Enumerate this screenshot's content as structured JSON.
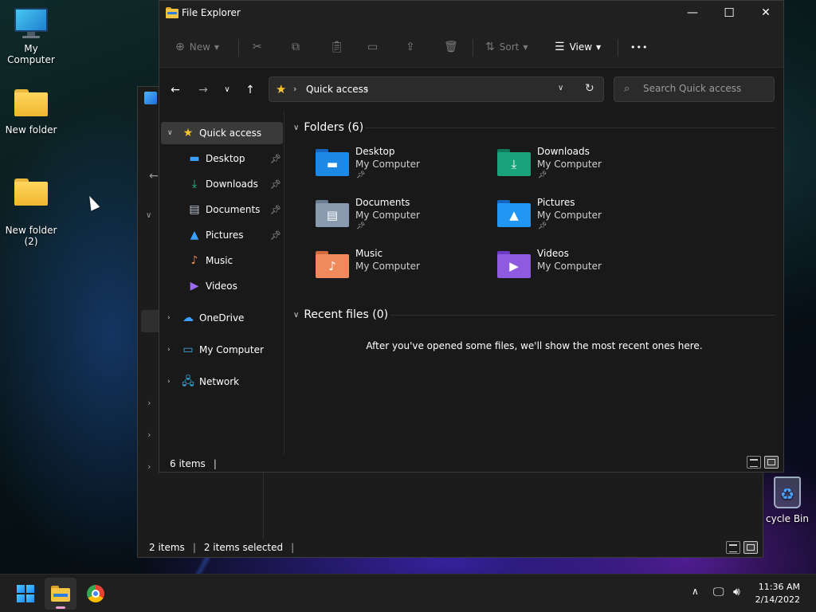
{
  "desktop": {
    "icons": [
      {
        "label": "My Computer",
        "icon": "monitor-icon"
      },
      {
        "label": "New folder",
        "icon": "folder-icon"
      },
      {
        "label": "New folder\n(2)",
        "icon": "folder-icon"
      }
    ],
    "recycle_bin_label": "cycle Bin"
  },
  "background_window": {
    "status_items_count": "2 items",
    "status_selected": "2 items selected"
  },
  "window": {
    "title": "File Explorer",
    "controls": {
      "minimize": "—",
      "maximize": "☐",
      "close": "✕"
    }
  },
  "command_bar": {
    "new_label": "New",
    "sort_label": "Sort",
    "view_label": "View",
    "more_label": "•••",
    "icons": [
      "new-icon",
      "cut-icon",
      "copy-icon",
      "paste-icon",
      "rename-icon",
      "share-icon",
      "delete-icon",
      "sort-icon",
      "view-icon",
      "more-icon"
    ]
  },
  "address_bar": {
    "path": "Quick access",
    "search_placeholder": "Search Quick access"
  },
  "nav_pane": {
    "quick_access": "Quick access",
    "pinned": [
      {
        "label": "Desktop",
        "pinned": true
      },
      {
        "label": "Downloads",
        "pinned": true
      },
      {
        "label": "Documents",
        "pinned": true
      },
      {
        "label": "Pictures",
        "pinned": true
      },
      {
        "label": "Music",
        "pinned": false
      },
      {
        "label": "Videos",
        "pinned": false
      }
    ],
    "roots": [
      {
        "label": "OneDrive"
      },
      {
        "label": "My Computer"
      },
      {
        "label": "Network"
      }
    ]
  },
  "content": {
    "folders_header": "Folders (6)",
    "folders": [
      {
        "name": "Desktop",
        "location": "My Computer",
        "pinned": true,
        "color": "#1e88e5"
      },
      {
        "name": "Downloads",
        "location": "My Computer",
        "pinned": true,
        "color": "#1aa37a"
      },
      {
        "name": "Documents",
        "location": "My Computer",
        "pinned": true,
        "color": "#8a9bb0"
      },
      {
        "name": "Pictures",
        "location": "My Computer",
        "pinned": true,
        "color": "#2196f3"
      },
      {
        "name": "Music",
        "location": "My Computer",
        "pinned": false,
        "color": "#f08a5d"
      },
      {
        "name": "Videos",
        "location": "My Computer",
        "pinned": false,
        "color": "#8e5be0"
      }
    ],
    "recent_header": "Recent files (0)",
    "recent_empty_message": "After you've opened some files, we'll show the most recent ones here."
  },
  "status_bar": {
    "items_count": "6 items"
  },
  "taskbar": {
    "time": "11:36 AM",
    "date": "2/14/2022"
  }
}
